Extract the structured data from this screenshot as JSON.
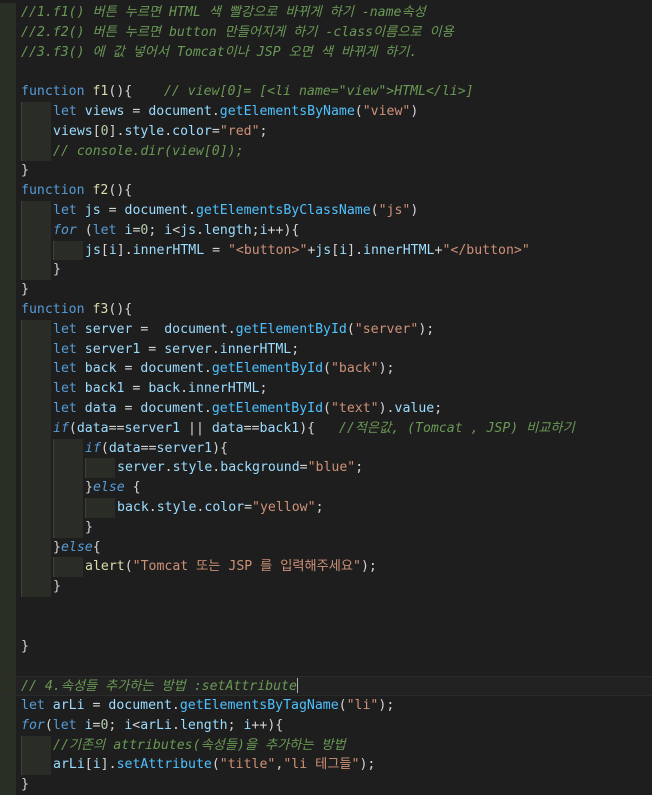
{
  "editor": {
    "language": "javascript",
    "theme_colors": {
      "background": "#1e1e1e",
      "comment": "#6a9955",
      "keyword": "#569cd6",
      "function": "#dcdcaa",
      "variable": "#9cdcfe",
      "string": "#ce9178",
      "number": "#b5cea8",
      "text": "#d4d4d4"
    },
    "lines": [
      {
        "indent": 0,
        "tokens": [
          {
            "t": "comment",
            "v": "//1.f1() 버튼 누르면 HTML 색 빨강으로 바뀌게 하기 -name속성"
          }
        ]
      },
      {
        "indent": 0,
        "tokens": [
          {
            "t": "comment",
            "v": "//2.f2() 버튼 누르면 button 만들어지게 하기 -class이름으로 이용"
          }
        ]
      },
      {
        "indent": 0,
        "tokens": [
          {
            "t": "comment",
            "v": "//3.f3() 에 값 넣어서 Tomcat이나 JSP 오면 색 바뀌게 하기."
          }
        ]
      },
      {
        "indent": 0,
        "tokens": []
      },
      {
        "indent": 0,
        "tokens": [
          {
            "t": "kw",
            "v": "function"
          },
          {
            "t": "plain",
            "v": " "
          },
          {
            "t": "fn",
            "v": "f1"
          },
          {
            "t": "punc",
            "v": "(){"
          },
          {
            "t": "plain",
            "v": "    "
          },
          {
            "t": "comment",
            "v": "// view[0]= [<li name=\"view\">HTML</li>]"
          }
        ]
      },
      {
        "indent": 1,
        "tokens": [
          {
            "t": "kw",
            "v": "let"
          },
          {
            "t": "plain",
            "v": " "
          },
          {
            "t": "var",
            "v": "views"
          },
          {
            "t": "op",
            "v": " = "
          },
          {
            "t": "var",
            "v": "document"
          },
          {
            "t": "punc",
            "v": "."
          },
          {
            "t": "method",
            "v": "getElementsByName"
          },
          {
            "t": "punc",
            "v": "("
          },
          {
            "t": "str",
            "v": "\"view\""
          },
          {
            "t": "punc",
            "v": ")"
          }
        ]
      },
      {
        "indent": 1,
        "tokens": [
          {
            "t": "var",
            "v": "views"
          },
          {
            "t": "punc",
            "v": "["
          },
          {
            "t": "num",
            "v": "0"
          },
          {
            "t": "punc",
            "v": "]."
          },
          {
            "t": "prop",
            "v": "style"
          },
          {
            "t": "punc",
            "v": "."
          },
          {
            "t": "prop",
            "v": "color"
          },
          {
            "t": "op",
            "v": "="
          },
          {
            "t": "str",
            "v": "\"red\""
          },
          {
            "t": "punc",
            "v": ";"
          }
        ]
      },
      {
        "indent": 1,
        "tokens": [
          {
            "t": "comment",
            "v": "// console.dir(view[0]);"
          }
        ]
      },
      {
        "indent": 0,
        "tokens": [
          {
            "t": "punc",
            "v": "}"
          }
        ]
      },
      {
        "indent": 0,
        "tokens": [
          {
            "t": "kw",
            "v": "function"
          },
          {
            "t": "plain",
            "v": " "
          },
          {
            "t": "fn",
            "v": "f2"
          },
          {
            "t": "punc",
            "v": "(){"
          }
        ]
      },
      {
        "indent": 1,
        "tokens": [
          {
            "t": "kw",
            "v": "let"
          },
          {
            "t": "plain",
            "v": " "
          },
          {
            "t": "var",
            "v": "js"
          },
          {
            "t": "op",
            "v": " = "
          },
          {
            "t": "var",
            "v": "document"
          },
          {
            "t": "punc",
            "v": "."
          },
          {
            "t": "method",
            "v": "getElementsByClassName"
          },
          {
            "t": "punc",
            "v": "("
          },
          {
            "t": "str",
            "v": "\"js\""
          },
          {
            "t": "punc",
            "v": ")"
          }
        ]
      },
      {
        "indent": 1,
        "tokens": [
          {
            "t": "ctrl",
            "v": "for"
          },
          {
            "t": "plain",
            "v": " ("
          },
          {
            "t": "kw",
            "v": "let"
          },
          {
            "t": "plain",
            "v": " "
          },
          {
            "t": "var",
            "v": "i"
          },
          {
            "t": "op",
            "v": "="
          },
          {
            "t": "num",
            "v": "0"
          },
          {
            "t": "punc",
            "v": "; "
          },
          {
            "t": "var",
            "v": "i"
          },
          {
            "t": "op",
            "v": "<"
          },
          {
            "t": "var",
            "v": "js"
          },
          {
            "t": "punc",
            "v": "."
          },
          {
            "t": "prop",
            "v": "length"
          },
          {
            "t": "punc",
            "v": ";"
          },
          {
            "t": "var",
            "v": "i"
          },
          {
            "t": "op",
            "v": "++"
          },
          {
            "t": "punc",
            "v": "){"
          }
        ]
      },
      {
        "indent": 2,
        "tokens": [
          {
            "t": "var",
            "v": "js"
          },
          {
            "t": "punc",
            "v": "["
          },
          {
            "t": "var",
            "v": "i"
          },
          {
            "t": "punc",
            "v": "]."
          },
          {
            "t": "prop",
            "v": "innerHTML"
          },
          {
            "t": "op",
            "v": " = "
          },
          {
            "t": "str",
            "v": "\"<button>\""
          },
          {
            "t": "op",
            "v": "+"
          },
          {
            "t": "var",
            "v": "js"
          },
          {
            "t": "punc",
            "v": "["
          },
          {
            "t": "var",
            "v": "i"
          },
          {
            "t": "punc",
            "v": "]."
          },
          {
            "t": "prop",
            "v": "innerHTML"
          },
          {
            "t": "op",
            "v": "+"
          },
          {
            "t": "str",
            "v": "\"</button>\""
          }
        ]
      },
      {
        "indent": 1,
        "tokens": [
          {
            "t": "punc",
            "v": "}"
          }
        ]
      },
      {
        "indent": 0,
        "tokens": [
          {
            "t": "punc",
            "v": "}"
          }
        ]
      },
      {
        "indent": 0,
        "tokens": [
          {
            "t": "kw",
            "v": "function"
          },
          {
            "t": "plain",
            "v": " "
          },
          {
            "t": "fn",
            "v": "f3"
          },
          {
            "t": "punc",
            "v": "(){"
          }
        ]
      },
      {
        "indent": 1,
        "tokens": [
          {
            "t": "kw",
            "v": "let"
          },
          {
            "t": "plain",
            "v": " "
          },
          {
            "t": "var",
            "v": "server"
          },
          {
            "t": "op",
            "v": " =  "
          },
          {
            "t": "var",
            "v": "document"
          },
          {
            "t": "punc",
            "v": "."
          },
          {
            "t": "method",
            "v": "getElementById"
          },
          {
            "t": "punc",
            "v": "("
          },
          {
            "t": "str",
            "v": "\"server\""
          },
          {
            "t": "punc",
            "v": ");"
          }
        ]
      },
      {
        "indent": 1,
        "tokens": [
          {
            "t": "kw",
            "v": "let"
          },
          {
            "t": "plain",
            "v": " "
          },
          {
            "t": "var",
            "v": "server1"
          },
          {
            "t": "op",
            "v": " = "
          },
          {
            "t": "var",
            "v": "server"
          },
          {
            "t": "punc",
            "v": "."
          },
          {
            "t": "prop",
            "v": "innerHTML"
          },
          {
            "t": "punc",
            "v": ";"
          }
        ]
      },
      {
        "indent": 1,
        "tokens": [
          {
            "t": "kw",
            "v": "let"
          },
          {
            "t": "plain",
            "v": " "
          },
          {
            "t": "var",
            "v": "back"
          },
          {
            "t": "op",
            "v": " = "
          },
          {
            "t": "var",
            "v": "document"
          },
          {
            "t": "punc",
            "v": "."
          },
          {
            "t": "method",
            "v": "getElementById"
          },
          {
            "t": "punc",
            "v": "("
          },
          {
            "t": "str",
            "v": "\"back\""
          },
          {
            "t": "punc",
            "v": ");"
          }
        ]
      },
      {
        "indent": 1,
        "tokens": [
          {
            "t": "kw",
            "v": "let"
          },
          {
            "t": "plain",
            "v": " "
          },
          {
            "t": "var",
            "v": "back1"
          },
          {
            "t": "op",
            "v": " = "
          },
          {
            "t": "var",
            "v": "back"
          },
          {
            "t": "punc",
            "v": "."
          },
          {
            "t": "prop",
            "v": "innerHTML"
          },
          {
            "t": "punc",
            "v": ";"
          }
        ]
      },
      {
        "indent": 1,
        "tokens": [
          {
            "t": "kw",
            "v": "let"
          },
          {
            "t": "plain",
            "v": " "
          },
          {
            "t": "var",
            "v": "data"
          },
          {
            "t": "op",
            "v": " = "
          },
          {
            "t": "var",
            "v": "document"
          },
          {
            "t": "punc",
            "v": "."
          },
          {
            "t": "method",
            "v": "getElementById"
          },
          {
            "t": "punc",
            "v": "("
          },
          {
            "t": "str",
            "v": "\"text\""
          },
          {
            "t": "punc",
            "v": ")."
          },
          {
            "t": "prop",
            "v": "value"
          },
          {
            "t": "punc",
            "v": ";"
          }
        ]
      },
      {
        "indent": 1,
        "tokens": [
          {
            "t": "ctrl",
            "v": "if"
          },
          {
            "t": "punc",
            "v": "("
          },
          {
            "t": "var",
            "v": "data"
          },
          {
            "t": "op",
            "v": "=="
          },
          {
            "t": "var",
            "v": "server1"
          },
          {
            "t": "op",
            "v": " || "
          },
          {
            "t": "var",
            "v": "data"
          },
          {
            "t": "op",
            "v": "=="
          },
          {
            "t": "var",
            "v": "back1"
          },
          {
            "t": "punc",
            "v": "){"
          },
          {
            "t": "plain",
            "v": "   "
          },
          {
            "t": "comment",
            "v": "//적은값, (Tomcat , JSP) 비교하기"
          }
        ]
      },
      {
        "indent": 2,
        "tokens": [
          {
            "t": "ctrl",
            "v": "if"
          },
          {
            "t": "punc",
            "v": "("
          },
          {
            "t": "var",
            "v": "data"
          },
          {
            "t": "op",
            "v": "=="
          },
          {
            "t": "var",
            "v": "server1"
          },
          {
            "t": "punc",
            "v": "){"
          }
        ]
      },
      {
        "indent": 3,
        "tokens": [
          {
            "t": "var",
            "v": "server"
          },
          {
            "t": "punc",
            "v": "."
          },
          {
            "t": "prop",
            "v": "style"
          },
          {
            "t": "punc",
            "v": "."
          },
          {
            "t": "prop",
            "v": "background"
          },
          {
            "t": "op",
            "v": "="
          },
          {
            "t": "str",
            "v": "\"blue\""
          },
          {
            "t": "punc",
            "v": ";"
          }
        ]
      },
      {
        "indent": 2,
        "tokens": [
          {
            "t": "punc",
            "v": "}"
          },
          {
            "t": "ctrl",
            "v": "else"
          },
          {
            "t": "punc",
            "v": " {"
          }
        ]
      },
      {
        "indent": 3,
        "tokens": [
          {
            "t": "var",
            "v": "back"
          },
          {
            "t": "punc",
            "v": "."
          },
          {
            "t": "prop",
            "v": "style"
          },
          {
            "t": "punc",
            "v": "."
          },
          {
            "t": "prop",
            "v": "color"
          },
          {
            "t": "op",
            "v": "="
          },
          {
            "t": "str",
            "v": "\"yellow\""
          },
          {
            "t": "punc",
            "v": ";"
          }
        ]
      },
      {
        "indent": 2,
        "tokens": [
          {
            "t": "punc",
            "v": "}"
          }
        ]
      },
      {
        "indent": 1,
        "tokens": [
          {
            "t": "punc",
            "v": "}"
          },
          {
            "t": "ctrl",
            "v": "else"
          },
          {
            "t": "punc",
            "v": "{"
          }
        ]
      },
      {
        "indent": 2,
        "tokens": [
          {
            "t": "fn",
            "v": "alert"
          },
          {
            "t": "punc",
            "v": "("
          },
          {
            "t": "str",
            "v": "\"Tomcat 또는 JSP 를 입력해주세요\""
          },
          {
            "t": "punc",
            "v": ");"
          }
        ]
      },
      {
        "indent": 1,
        "tokens": [
          {
            "t": "punc",
            "v": "}"
          }
        ]
      },
      {
        "indent": 0,
        "tokens": []
      },
      {
        "indent": 0,
        "tokens": []
      },
      {
        "indent": 0,
        "tokens": [
          {
            "t": "punc",
            "v": "}"
          }
        ]
      },
      {
        "indent": 0,
        "tokens": []
      },
      {
        "indent": 0,
        "current": true,
        "caret": true,
        "tokens": [
          {
            "t": "comment",
            "v": "// 4.속성들 추가하는 방법 :setAttribute"
          }
        ]
      },
      {
        "indent": 0,
        "tokens": [
          {
            "t": "kw",
            "v": "let"
          },
          {
            "t": "plain",
            "v": " "
          },
          {
            "t": "var",
            "v": "arLi"
          },
          {
            "t": "op",
            "v": " = "
          },
          {
            "t": "var",
            "v": "document"
          },
          {
            "t": "punc",
            "v": "."
          },
          {
            "t": "method",
            "v": "getElementsByTagName"
          },
          {
            "t": "punc",
            "v": "("
          },
          {
            "t": "str",
            "v": "\"li\""
          },
          {
            "t": "punc",
            "v": ");"
          }
        ]
      },
      {
        "indent": 0,
        "tokens": [
          {
            "t": "ctrl",
            "v": "for"
          },
          {
            "t": "punc",
            "v": "("
          },
          {
            "t": "kw",
            "v": "let"
          },
          {
            "t": "plain",
            "v": " "
          },
          {
            "t": "var",
            "v": "i"
          },
          {
            "t": "op",
            "v": "="
          },
          {
            "t": "num",
            "v": "0"
          },
          {
            "t": "punc",
            "v": "; "
          },
          {
            "t": "var",
            "v": "i"
          },
          {
            "t": "op",
            "v": "<"
          },
          {
            "t": "var",
            "v": "arLi"
          },
          {
            "t": "punc",
            "v": "."
          },
          {
            "t": "prop",
            "v": "length"
          },
          {
            "t": "punc",
            "v": "; "
          },
          {
            "t": "var",
            "v": "i"
          },
          {
            "t": "op",
            "v": "++"
          },
          {
            "t": "punc",
            "v": "){"
          }
        ]
      },
      {
        "indent": 1,
        "tokens": [
          {
            "t": "comment",
            "v": "//기존의 attributes(속성들)을 추가하는 방법"
          }
        ]
      },
      {
        "indent": 1,
        "tokens": [
          {
            "t": "var",
            "v": "arLi"
          },
          {
            "t": "punc",
            "v": "["
          },
          {
            "t": "var",
            "v": "i"
          },
          {
            "t": "punc",
            "v": "]."
          },
          {
            "t": "method",
            "v": "setAttribute"
          },
          {
            "t": "punc",
            "v": "("
          },
          {
            "t": "str",
            "v": "\"title\""
          },
          {
            "t": "punc",
            "v": ","
          },
          {
            "t": "str",
            "v": "\"li 테그들\""
          },
          {
            "t": "punc",
            "v": ");"
          }
        ]
      },
      {
        "indent": 0,
        "tokens": [
          {
            "t": "punc",
            "v": "}"
          }
        ]
      }
    ]
  }
}
